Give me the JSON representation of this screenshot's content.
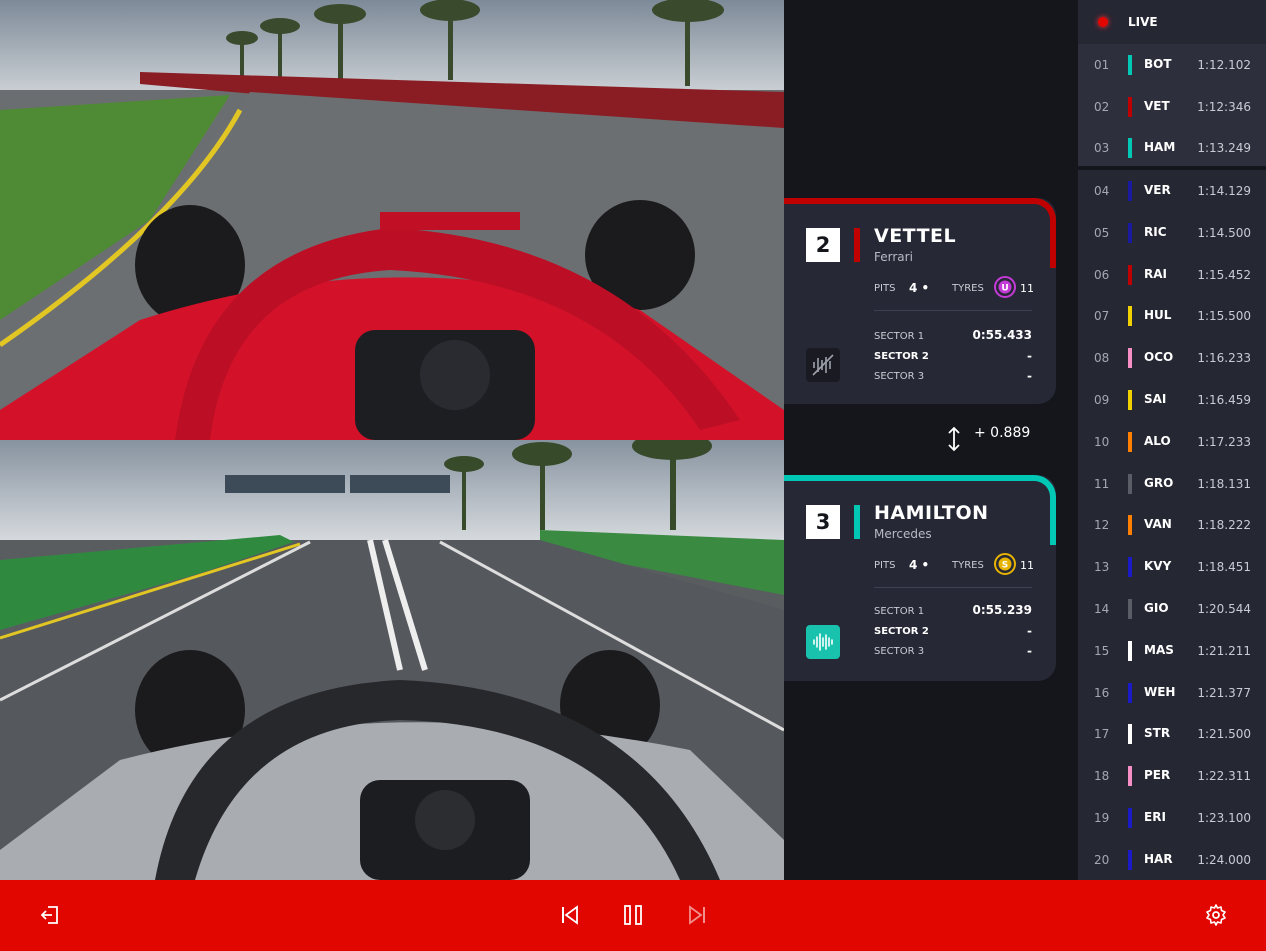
{
  "colors": {
    "accent": "#e10600",
    "ferrari": "#c00000",
    "mercedes": "#00c8b4",
    "background": "#15161c",
    "card": "#262835",
    "board": "#252733"
  },
  "feeds": {
    "top": {
      "driver": "VETTEL",
      "car": "ferrari"
    },
    "bottom": {
      "driver": "HAMILTON",
      "car": "mercedes"
    }
  },
  "card_top": {
    "position": "2",
    "driver": "VETTEL",
    "team": "Ferrari",
    "team_color": "#c00000",
    "pits_label": "PITS",
    "pits_value": "4",
    "tyres_label": "TYRES",
    "tyre_compound_letter": "U",
    "tyre_color": "#c33ad6",
    "tyre_laps": "11",
    "sectors": [
      {
        "label": "SECTOR 1",
        "value": "0:55.433"
      },
      {
        "label": "SECTOR 2",
        "value": "-"
      },
      {
        "label": "SECTOR 3",
        "value": "-"
      }
    ],
    "radio_icon": "radio-muted-icon"
  },
  "gap": {
    "value": "+ 0.889",
    "icon": "swap-vertical-icon"
  },
  "card_bottom": {
    "position": "3",
    "driver": "HAMILTON",
    "team": "Mercedes",
    "team_color": "#00c8b4",
    "pits_label": "PITS",
    "pits_value": "4",
    "tyres_label": "TYRES",
    "tyre_compound_letter": "S",
    "tyre_color": "#e5b300",
    "tyre_laps": "11",
    "sectors": [
      {
        "label": "SECTOR 1",
        "value": "0:55.239"
      },
      {
        "label": "SECTOR 2",
        "value": "-"
      },
      {
        "label": "SECTOR 3",
        "value": "-"
      }
    ],
    "radio_icon": "radio-waveform-icon"
  },
  "leaderboard": {
    "live_label": "LIVE",
    "rows": [
      {
        "pos": "01",
        "code": "BOT",
        "time": "1:12.102",
        "color": "#00c8b4"
      },
      {
        "pos": "02",
        "code": "VET",
        "time": "1:12:346",
        "color": "#c00000"
      },
      {
        "pos": "03",
        "code": "HAM",
        "time": "1:13.249",
        "color": "#00c8b4"
      },
      {
        "pos": "04",
        "code": "VER",
        "time": "1:14.129",
        "color": "#1a1aa0"
      },
      {
        "pos": "05",
        "code": "RIC",
        "time": "1:14.500",
        "color": "#1a1aa0"
      },
      {
        "pos": "06",
        "code": "RAI",
        "time": "1:15.452",
        "color": "#c00000"
      },
      {
        "pos": "07",
        "code": "HUL",
        "time": "1:15.500",
        "color": "#f2d100"
      },
      {
        "pos": "08",
        "code": "OCO",
        "time": "1:16.233",
        "color": "#f58fc6"
      },
      {
        "pos": "09",
        "code": "SAI",
        "time": "1:16.459",
        "color": "#f2d100"
      },
      {
        "pos": "10",
        "code": "ALO",
        "time": "1:17.233",
        "color": "#ff8000"
      },
      {
        "pos": "11",
        "code": "GRO",
        "time": "1:18.131",
        "color": "#5a5c66"
      },
      {
        "pos": "12",
        "code": "VAN",
        "time": "1:18.222",
        "color": "#ff8000"
      },
      {
        "pos": "13",
        "code": "KVY",
        "time": "1:18.451",
        "color": "#1a1ac8"
      },
      {
        "pos": "14",
        "code": "GIO",
        "time": "1:20.544",
        "color": "#5a5c66"
      },
      {
        "pos": "15",
        "code": "MAS",
        "time": "1:21.211",
        "color": "#ffffff"
      },
      {
        "pos": "16",
        "code": "WEH",
        "time": "1:21.377",
        "color": "#1a1ac8"
      },
      {
        "pos": "17",
        "code": "STR",
        "time": "1:21.500",
        "color": "#ffffff"
      },
      {
        "pos": "18",
        "code": "PER",
        "time": "1:22.311",
        "color": "#f58fc6"
      },
      {
        "pos": "19",
        "code": "ERI",
        "time": "1:23.100",
        "color": "#1a1ac8"
      },
      {
        "pos": "20",
        "code": "HAR",
        "time": "1:24.000",
        "color": "#1a1ac8"
      }
    ]
  },
  "controls": {
    "exit": "exit-icon",
    "previous": "skip-previous-icon",
    "pause": "pause-icon",
    "next": "skip-next-icon",
    "settings": "gear-icon"
  }
}
